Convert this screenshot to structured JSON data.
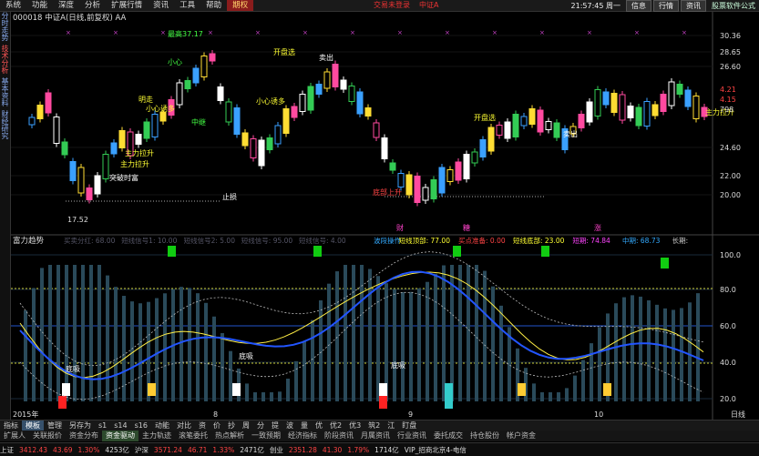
{
  "topbar": {
    "menu": [
      "系统",
      "功能",
      "深度",
      "分析",
      "扩展行情",
      "资讯",
      "工具",
      "帮助",
      "期权"
    ],
    "active_index": 8,
    "center": [
      "交易未登录",
      "中证A"
    ],
    "clock": "21:57:45 周一",
    "buttons": [
      "信息",
      "行情",
      "资讯"
    ],
    "brand": "股票软件公式"
  },
  "leftbar": {
    "labels": [
      "分时走势",
      "技术分析",
      "基本资料",
      "财经研究"
    ]
  },
  "main_chart": {
    "title": "000018 中证A(日线,前复权) AA",
    "price_scale": [
      "30.36",
      "28.65",
      "26.60",
      "24.60",
      "22.00",
      "20.00"
    ],
    "right_values": [
      {
        "text": "30.36",
        "color": "#ddd"
      },
      {
        "text": "28.65",
        "color": "#ddd"
      },
      {
        "text": "26.60",
        "color": "#ddd"
      },
      {
        "text": "4.21",
        "color": "#f44"
      },
      {
        "text": "4.15",
        "color": "#f44"
      },
      {
        "text": "798",
        "color": "#ddd"
      },
      {
        "text": "24.60",
        "color": "#ddd"
      },
      {
        "text": "22.00",
        "color": "#ddd"
      },
      {
        "text": "20.00",
        "color": "#ddd"
      }
    ],
    "annotations": [
      {
        "text": "最高37.17",
        "color": "#4f4"
      },
      {
        "text": "开盘选",
        "color": "#ff3"
      },
      {
        "text": "卖出",
        "color": "#fff"
      },
      {
        "text": "小心",
        "color": "#4f4"
      },
      {
        "text": "明走",
        "color": "#ff3"
      },
      {
        "text": "小心诱多",
        "color": "#ff3"
      },
      {
        "text": "主力拉升",
        "color": "#ff3"
      },
      {
        "text": "突破时富",
        "color": "#fff"
      },
      {
        "text": "止损",
        "color": "#fff"
      },
      {
        "text": "中继",
        "color": "#4f4"
      },
      {
        "text": "开盘选",
        "color": "#ff3"
      },
      {
        "text": "卖出",
        "color": "#fff"
      },
      {
        "text": "底部上升",
        "color": "#f44"
      },
      {
        "text": "主力拉升",
        "color": "#ff3"
      },
      {
        "text": "小心诱多",
        "color": "#ff3"
      },
      {
        "text": "主力拉升",
        "color": "#ff3"
      }
    ],
    "low_label": "17.52",
    "footer_labels": [
      "财",
      "糖",
      "涨"
    ]
  },
  "indicator": {
    "name": "富力趋势",
    "params": [
      {
        "text": "买卖分红: 68.00",
        "color": "#556"
      },
      {
        "text": "短线信号1: 10.00",
        "color": "#556"
      },
      {
        "text": "短线信号2: 5.00",
        "color": "#556"
      },
      {
        "text": "短线信号: 95.00",
        "color": "#556"
      },
      {
        "text": "短线信号: 4.00",
        "color": "#556"
      }
    ],
    "values": [
      {
        "text": "波段操作",
        "color": "#3af"
      },
      {
        "text": "短线顶部: 77.00",
        "color": "#ff3"
      },
      {
        "text": "买点准备: 0.00",
        "color": "#f44"
      },
      {
        "text": "短线底部: 23.00",
        "color": "#ff3"
      },
      {
        "text": "短期: 74.84",
        "color": "#f4f"
      },
      {
        "text": "中期: 68.73",
        "color": "#3af"
      },
      {
        "text": "长期:",
        "color": "#ccc"
      }
    ],
    "scale": [
      "100.0",
      "80.0",
      "60.0",
      "40.0",
      "20.0"
    ],
    "labels": [
      "底吸",
      "底吸",
      "底吸"
    ]
  },
  "time_axis": {
    "labels": [
      "2015年",
      "8",
      "9",
      "10",
      "日线"
    ]
  },
  "tabs": [
    "指标",
    "模板",
    "管理",
    "另存为",
    "s1",
    "s14",
    "s16",
    "动能",
    "对比",
    "资",
    "价",
    "抄",
    "周",
    "分",
    "提",
    "波",
    "量",
    "优",
    "优2",
    "优3",
    "筑2",
    "江",
    "盯盘"
  ],
  "tabs_active": 1,
  "tabs2": [
    "扩展人",
    "关联报价",
    "资金分布",
    "资金驱动",
    "主力轨迹",
    "滚笔委托",
    "热点解析",
    "一致预期",
    "经济指标",
    "阶段资讯",
    "月属资讯",
    "行业资讯",
    "委托成交",
    "持仓股份",
    "帐户资金"
  ],
  "tabs2_active": 3,
  "status": [
    {
      "text": "上证",
      "color": "#ddd"
    },
    {
      "text": "3412.43",
      "color": "#f44"
    },
    {
      "text": "43.69",
      "color": "#f44"
    },
    {
      "text": "1.30%",
      "color": "#f44"
    },
    {
      "text": "4253亿",
      "color": "#ddd"
    },
    {
      "text": "沪深",
      "color": "#ddd"
    },
    {
      "text": "3571.24",
      "color": "#f44"
    },
    {
      "text": "46.71",
      "color": "#f44"
    },
    {
      "text": "1.33%",
      "color": "#f44"
    },
    {
      "text": "2471亿",
      "color": "#ddd"
    },
    {
      "text": "创业",
      "color": "#ddd"
    },
    {
      "text": "2351.28",
      "color": "#f44"
    },
    {
      "text": "41.30",
      "color": "#f44"
    },
    {
      "text": "1.79%",
      "color": "#f44"
    },
    {
      "text": "1714亿",
      "color": "#ddd"
    },
    {
      "text": "VIP_招商北京4-电信",
      "color": "#ddd"
    }
  ]
}
